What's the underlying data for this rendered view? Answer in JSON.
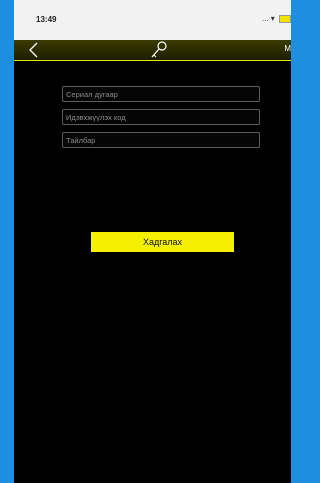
{
  "status_bar": {
    "time": "13:49",
    "icons": "... ▾"
  },
  "nav": {
    "right_label": "M"
  },
  "form": {
    "serial_placeholder": "Сериал дугаар",
    "code_placeholder": "Идэвхжүүлэх код",
    "note_placeholder": "Тайлбар",
    "submit_label": "Хадгалах"
  },
  "colors": {
    "accent": "#f5ef00",
    "background": "#000000",
    "frame": "#1d8fe0"
  },
  "icons": {
    "back": "chevron-left-icon",
    "center": "key-icon"
  }
}
